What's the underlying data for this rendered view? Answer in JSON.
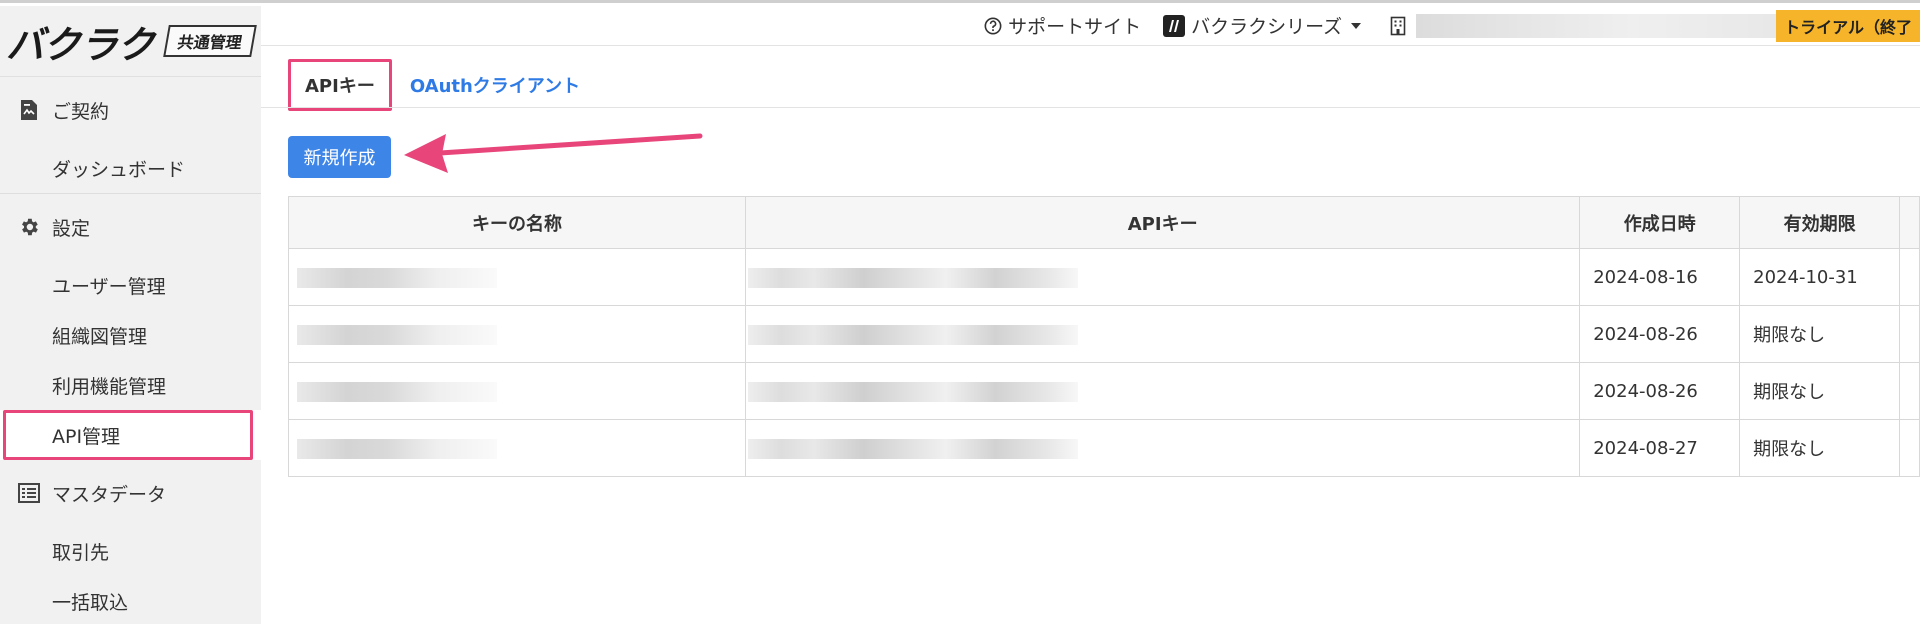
{
  "sidebar": {
    "logo": "バクラク",
    "logo_badge": "共通管理",
    "sections": [
      {
        "label": "ご契約",
        "icon": "contract-document-icon",
        "items": [
          "ダッシュボード"
        ]
      },
      {
        "label": "設定",
        "icon": "gear-icon",
        "items": [
          "ユーザー管理",
          "組織図管理",
          "利用機能管理",
          "API管理"
        ]
      },
      {
        "label": "マスタデータ",
        "icon": "list-icon",
        "items": [
          "取引先",
          "一括取込"
        ]
      }
    ],
    "active_item": "API管理"
  },
  "topbar": {
    "support": "サポートサイト",
    "series": "バクラクシリーズ",
    "trial": "トライアル（終了"
  },
  "tabs": [
    {
      "label": "APIキー",
      "active": true
    },
    {
      "label": "OAuthクライアント",
      "active": false
    }
  ],
  "toolbar": {
    "new_button": "新規作成",
    "accent_color": "#e8457a",
    "button_color": "#3e85e8"
  },
  "table": {
    "headers": [
      "キーの名称",
      "APIキー",
      "作成日時",
      "有効期限"
    ],
    "rows": [
      {
        "created": "2024-08-16",
        "expires": "2024-10-31"
      },
      {
        "created": "2024-08-26",
        "expires": "期限なし"
      },
      {
        "created": "2024-08-26",
        "expires": "期限なし"
      },
      {
        "created": "2024-08-27",
        "expires": "期限なし"
      }
    ]
  }
}
